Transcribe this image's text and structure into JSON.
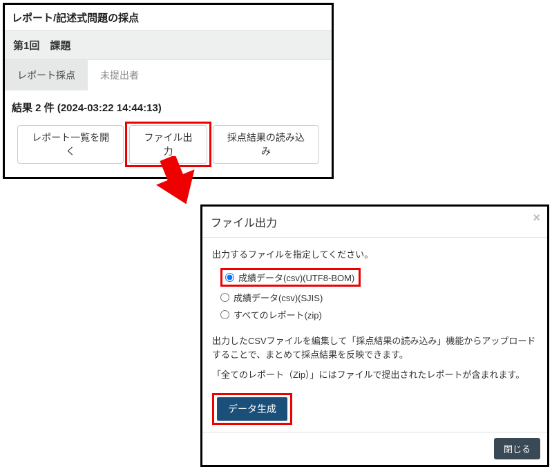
{
  "panel": {
    "title": "レポート/記述式問題の採点",
    "subtitle": "第1回　課題",
    "tabs": {
      "active": "レポート採点",
      "inactive": "未提出者"
    },
    "result_label": "結果 2 件 (2024-03:22 14:44:13)",
    "buttons": {
      "open_list": "レポート一覧を開く",
      "file_output": "ファイル出力",
      "import_results": "採点結果の読み込み"
    }
  },
  "dialog": {
    "title": "ファイル出力",
    "instruction": "出力するファイルを指定してください。",
    "options": {
      "opt1": "成績データ(csv)(UTF8-BOM)",
      "opt2": "成績データ(csv)(SJIS)",
      "opt3": "すべてのレポート(zip)"
    },
    "para1": "出力したCSVファイルを編集して「採点結果の読み込み」機能からアップロードすることで、まとめて採点結果を反映できます。",
    "para2": "「全てのレポート（Zip）」にはファイルで提出されたレポートが含まれます。",
    "generate": "データ生成",
    "close": "閉じる"
  }
}
